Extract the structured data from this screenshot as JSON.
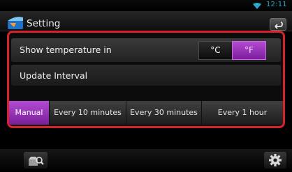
{
  "status": {
    "time": "12:11",
    "icons": [
      "wifi-icon"
    ],
    "accent_color": "#2aa7c9"
  },
  "header": {
    "title": "Setting",
    "icon": "settings-app-icon",
    "back_icon": "back-arrow-icon"
  },
  "settings": {
    "temperature": {
      "label": "Show temperature in",
      "options": [
        "°C",
        "°F"
      ],
      "selected": "°F"
    },
    "interval": {
      "label": "Update Interval",
      "options": [
        "Manual",
        "Every 10 minutes",
        "Every 30 minutes",
        "Every 1 hour"
      ],
      "selected": "Manual"
    }
  },
  "colors": {
    "highlight": "#d6222a",
    "selected": "#9b33bf"
  },
  "bottom": {
    "left_icon": "map-search-icon",
    "right_icon": "gear-icon"
  }
}
